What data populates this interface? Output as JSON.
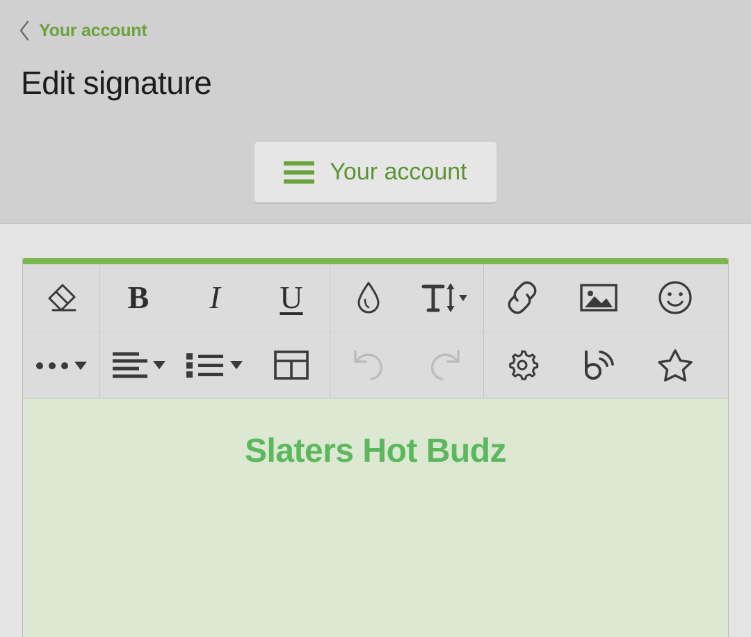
{
  "header": {
    "back_label": "Your account",
    "back_icon": "chevron-left-icon",
    "page_title": "Edit signature",
    "account_button": {
      "label": "Your account",
      "icon": "hamburger-menu-icon"
    }
  },
  "colors": {
    "accent_green": "#7ab84f",
    "link_green": "#6aa33c",
    "signature_green": "#5cb85c",
    "header_bg": "#d0d0d0",
    "page_bg": "#e4e4e4",
    "toolbar_bg": "#dcdcdc",
    "content_bg": "#dde8d3"
  },
  "editor": {
    "toolbar_rows": [
      {
        "groups": [
          {
            "buttons": [
              {
                "name": "eraser-icon",
                "title": "Clear formatting",
                "enabled": true
              }
            ]
          },
          {
            "buttons": [
              {
                "name": "bold-icon",
                "title": "Bold",
                "label": "B",
                "enabled": true
              },
              {
                "name": "italic-icon",
                "title": "Italic",
                "label": "I",
                "enabled": true
              },
              {
                "name": "underline-icon",
                "title": "Underline",
                "label": "U",
                "enabled": true
              }
            ]
          },
          {
            "buttons": [
              {
                "name": "text-color-droplet-icon",
                "title": "Text color",
                "enabled": true
              },
              {
                "name": "font-size-icon",
                "title": "Font size",
                "enabled": true,
                "has_caret": true
              }
            ]
          },
          {
            "buttons": [
              {
                "name": "link-icon",
                "title": "Insert link",
                "enabled": true
              },
              {
                "name": "image-icon",
                "title": "Insert image",
                "enabled": true
              },
              {
                "name": "emoji-smiley-icon",
                "title": "Insert emoji",
                "enabled": true
              }
            ]
          }
        ]
      },
      {
        "groups": [
          {
            "buttons": [
              {
                "name": "more-options-icon",
                "title": "More options",
                "enabled": true,
                "has_caret": true
              }
            ]
          },
          {
            "buttons": [
              {
                "name": "align-left-icon",
                "title": "Alignment",
                "enabled": true,
                "has_caret": true
              },
              {
                "name": "bullet-list-icon",
                "title": "Lists",
                "enabled": true,
                "has_caret": true
              },
              {
                "name": "table-icon",
                "title": "Insert table",
                "enabled": true
              }
            ]
          },
          {
            "buttons": [
              {
                "name": "undo-icon",
                "title": "Undo",
                "enabled": false
              },
              {
                "name": "redo-icon",
                "title": "Redo",
                "enabled": false
              }
            ]
          },
          {
            "buttons": [
              {
                "name": "gear-icon",
                "title": "Settings",
                "enabled": true
              },
              {
                "name": "blog-signal-icon",
                "title": "Blog",
                "enabled": true
              },
              {
                "name": "star-icon",
                "title": "Favorite",
                "enabled": true
              }
            ]
          }
        ]
      }
    ],
    "content": {
      "signature_text": "Slaters Hot Budz"
    }
  }
}
